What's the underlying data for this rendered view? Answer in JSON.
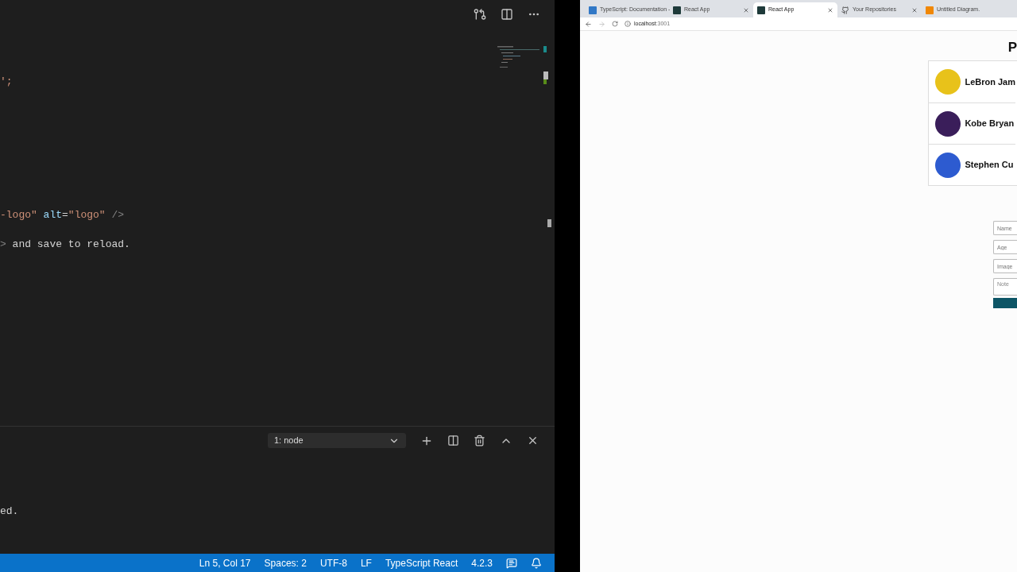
{
  "editor": {
    "code_lines": [
      {
        "tokens": [
          {
            "kind": "string",
            "text": "';"
          }
        ]
      },
      {
        "tokens": [
          {
            "kind": "string",
            "text": "-logo\" "
          },
          {
            "kind": "attr",
            "text": "alt"
          },
          {
            "kind": "plain",
            "text": "="
          },
          {
            "kind": "string",
            "text": "\"logo\" "
          },
          {
            "kind": "punct",
            "text": "/>"
          }
        ]
      },
      {
        "tokens": [
          {
            "kind": "punct",
            "text": ">"
          },
          {
            "kind": "plain",
            "text": " and save to reload."
          }
        ]
      }
    ]
  },
  "terminal": {
    "selector": "1: node",
    "lines": [
      "ed."
    ]
  },
  "status_bar": {
    "items": [
      "Ln 5, Col 17",
      "Spaces: 2",
      "UTF-8",
      "LF",
      "TypeScript React",
      "4.2.3"
    ]
  },
  "browser": {
    "tabs": [
      {
        "title": "TypeScript: Documentation -",
        "kind": "ts",
        "selected": false
      },
      {
        "title": "React App",
        "kind": "react",
        "selected": false
      },
      {
        "title": "React App",
        "kind": "react",
        "selected": true
      },
      {
        "title": "Your Repositories",
        "kind": "github",
        "selected": false
      },
      {
        "title": "Untitled Diagram.",
        "kind": "diagram",
        "selected": false
      }
    ],
    "address": {
      "host": "localhost",
      "port": ":3001"
    },
    "page": {
      "heading": "P",
      "players": [
        {
          "name": "LeBron Jam",
          "color": "#e8c21a"
        },
        {
          "name": "Kobe Bryan",
          "color": "#3a1e5a"
        },
        {
          "name": "Stephen Cu",
          "color": "#2d5bd0"
        }
      ],
      "form": {
        "fields": [
          {
            "placeholder": "Name",
            "kind": "input"
          },
          {
            "placeholder": "Age",
            "kind": "input"
          },
          {
            "placeholder": "Image",
            "kind": "input"
          },
          {
            "placeholder": "Note",
            "kind": "textarea"
          }
        ]
      }
    }
  }
}
